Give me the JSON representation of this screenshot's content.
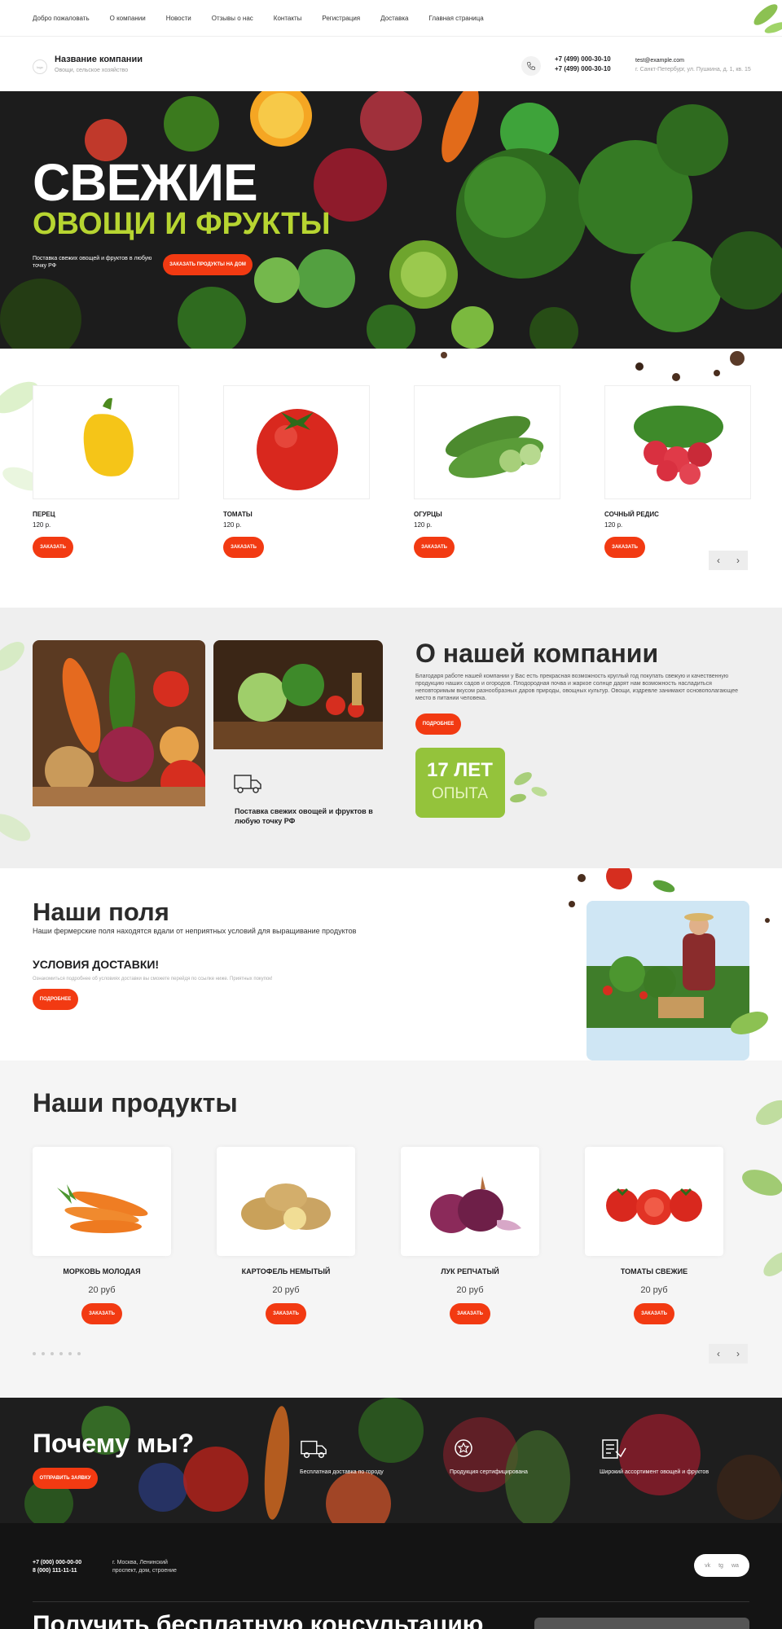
{
  "topnav": {
    "items": [
      "Добро пожаловать",
      "О компании",
      "Новости",
      "Отзывы о нас",
      "Контакты",
      "Регистрация",
      "Доставка",
      "Главная страница"
    ]
  },
  "header": {
    "logo_text": "logo",
    "company_name": "Название компании",
    "company_sub": "Овощи, сельское хозяйство",
    "phone1": "+7 (499) 000-30-10",
    "phone2": "+7 (499) 000-30-10",
    "email": "test@example.com",
    "address": "г. Санкт-Петербург, ул. Пушкина, д. 1, кв. 15"
  },
  "hero": {
    "title1": "СВЕЖИЕ",
    "title2": "ОВОЩИ И ФРУКТЫ",
    "text": "Поставка свежих овощей и фруктов в любую точку РФ",
    "button": "ЗАКАЗАТЬ ПРОДУКТЫ НА ДОМ"
  },
  "carousel1": {
    "items": [
      {
        "name": "ПЕРЕЦ",
        "price": "120 р.",
        "button": "ЗАКАЗАТЬ"
      },
      {
        "name": "ТОМАТЫ",
        "price": "120 р.",
        "button": "ЗАКАЗАТЬ"
      },
      {
        "name": "ОГУРЦЫ",
        "price": "120 р.",
        "button": "ЗАКАЗАТЬ"
      },
      {
        "name": "СОЧНЫЙ РЕДИС",
        "price": "120 р.",
        "button": "ЗАКАЗАТЬ"
      }
    ],
    "prev": "‹",
    "next": "›"
  },
  "about": {
    "title": "О нашей компании",
    "text": "Благодаря работе нашей компании у Вас есть прекрасная возможность круглый год покупать свежую и качественную продукцию наших садов и огородов. Плодородная почва и жаркое солнце дарят нам возможность насладиться неповторимым вкусом разнообразных даров природы, овощных культур. Овощи, издревле занимают основополагающее место в питании человека.",
    "button": "ПОДРОБНЕЕ",
    "badge_big": "17 ЛЕТ",
    "badge_small": "ОПЫТА",
    "delivery": "Поставка свежих овощей и фруктов в любую точку РФ"
  },
  "fields": {
    "title": "Наши поля",
    "sub": "Наши фермерские поля находятся вдали от неприятных условий для выращивание продуктов",
    "cond_title": "УСЛОВИЯ ДОСТАВКИ!",
    "cond_text": "Ознакомиться подробнее об условиях доставки вы сможете перейдя по ссылке ниже. Приятных покупок!",
    "button": "ПОДРОБНЕЕ"
  },
  "products": {
    "title": "Наши продукты",
    "items": [
      {
        "name": "МОРКОВЬ МОЛОДАЯ",
        "price": "20 руб",
        "button": "ЗАКАЗАТЬ"
      },
      {
        "name": "КАРТОФЕЛЬ НЕМЫТЫЙ",
        "price": "20 руб",
        "button": "ЗАКАЗАТЬ"
      },
      {
        "name": "ЛУК РЕПЧАТЫЙ",
        "price": "20 руб",
        "button": "ЗАКАЗАТЬ"
      },
      {
        "name": "ТОМАТЫ СВЕЖИЕ",
        "price": "20 руб",
        "button": "ЗАКАЗАТЬ"
      }
    ],
    "prev": "‹",
    "next": "›"
  },
  "why": {
    "title": "Почему мы?",
    "button": "ОТПРАВИТЬ ЗАЯВКУ",
    "features": [
      {
        "icon": "truck-icon",
        "text": "Бесплатная доставка по городу"
      },
      {
        "icon": "certificate-icon",
        "text": "Продукция сертифицирована"
      },
      {
        "icon": "basket-icon",
        "text": "Широкий ассортимент овощей и фруктов"
      }
    ]
  },
  "footer": {
    "phone1": "+7 (000) 000-00-00",
    "phone2": "8 (000) 111-11-11",
    "addr1": "г. Москва, Ленинский",
    "addr2": "проспект, дом, строение",
    "social": [
      "vk",
      "tg",
      "wa"
    ],
    "consult": "Получить бесплатную консультацию"
  },
  "colors": {
    "accent": "#f23a12",
    "green": "#b7d531",
    "badge": "#94c33b",
    "dark": "#1f1f1f"
  }
}
